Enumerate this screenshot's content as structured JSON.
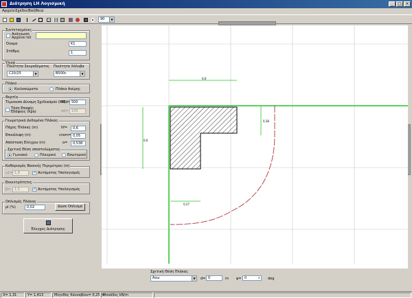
{
  "window": {
    "title": "Διάτρηση LH Λογισμική",
    "minimize": "_",
    "maximize": "□",
    "close": "×"
  },
  "menu": [
    "Αρχείο",
    "Σχέδιο",
    "Βοήθεια"
  ],
  "toolbar": {
    "zoom": "90",
    "icons": [
      "new-file-icon",
      "open-folder-icon",
      "save-icon",
      "cut-icon",
      "line-icon",
      "rectangle-icon",
      "table-icon",
      "grid-icon",
      "color-icon",
      "run-icon",
      "print-icon",
      "settings-icon"
    ]
  },
  "panel": {
    "coord": {
      "title": "Συντεταγμένες",
      "read_label": "Ανάγνωση Αρχείου txt",
      "read_value": "",
      "name_label": "Όνομα",
      "name_value": "Κ1",
      "level_label": "Στάθμη",
      "level_value": "1"
    },
    "materials": {
      "title": "Υλικά",
      "concrete_label": "Ποιότητα Σκυροδέματος",
      "concrete_value": "C20/25",
      "steel_label": "Ποιότητα Χάλυβα",
      "steel_value": "B500c"
    },
    "slab": {
      "title": "Πλάκα",
      "option1": "Κοιλοσώματα",
      "option2": "Πλάκα Ανέμης"
    },
    "loads": {
      "title": "Φορτία",
      "ved_label": "Τέμνουσα Δύναμη Σχεδιασμού (KN)",
      "ved_sym": "VEd=",
      "ved_value": "500",
      "soil_label": "Τάση Επαφής Εδάφους (Kpa)",
      "soil_sym": "σd=",
      "soil_value": "100"
    },
    "geometry": {
      "title": "Γεωμετρικά Δεδομένα Πλάκας",
      "thickness_label": "Πάχος Πλάκας (m)",
      "thickness_sym": "hf=",
      "thickness_value": "0,6",
      "cover_label": "Επικάλυψη (m)",
      "cover_sym": "cnom=",
      "cover_value": "0,05",
      "dist_label": "Απόσταση Ελέγχου (m)",
      "dist_sym": "α=",
      "dist_value": "0,538",
      "pos_title": "Σχετική Θέση υποστυλώματος",
      "pos1": "Γωνιακό",
      "pos2": "Πλευρικό",
      "pos3": "Εσωτερικό"
    },
    "perimeter": {
      "title": "Καθορισμός Βασικής Περιμέτρου (m)",
      "u1_sym": "u1=",
      "u1_value": "1,8",
      "auto_label": "Αυτόματος Υπολογισμός"
    },
    "eccentricity": {
      "title": "Εκκεντρότητες",
      "beta_sym": "β=",
      "beta_value": "1,5",
      "auto_label": "Αυτόματος Υπολογισμός"
    },
    "reinforcement": {
      "title": "Οπλισμός Πλάκας",
      "rho_label": "ρl (%)",
      "rho_value": "0,02",
      "button": "Δώσε Οπλισμό"
    },
    "check_button": "Έλεγχος Διάτρησης"
  },
  "drawing": {
    "dim_top": "0,6",
    "dim_left": "0,6",
    "dim_right": "0,38",
    "dim_bottom": "0,27"
  },
  "bottom": {
    "title": "Σχετική Θέση Πλάκας",
    "position": "Άνω",
    "d_label": "d=",
    "d_value": "0",
    "d_unit": "m",
    "phi_label": "φ=",
    "phi_value": "0",
    "phi_unit": "deg"
  },
  "status": {
    "x": "X= 1,31",
    "y": "Y= 1,413",
    "grid": "Μέγεθος Κανναβίου= 0,25 m",
    "units": "Μονάδες kN/m"
  }
}
